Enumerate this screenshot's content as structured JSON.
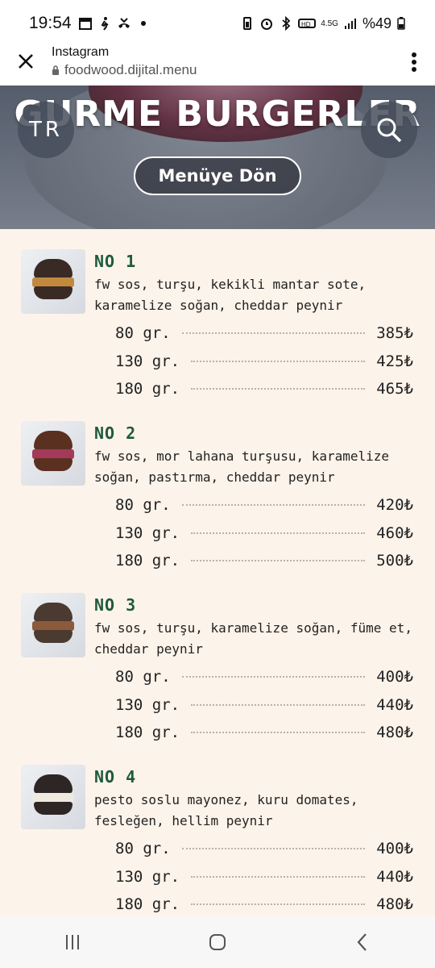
{
  "status_bar": {
    "time": "19:54",
    "left_icons": [
      "calendar-icon",
      "walking-icon",
      "missed-call-icon",
      "dot-icon"
    ],
    "right_icons": [
      "battery-saver-icon",
      "alarm-icon",
      "bluetooth-icon",
      "hd-voice-icon",
      "signal-icon"
    ],
    "network": "4.5G",
    "battery": "%49"
  },
  "browser": {
    "title": "Instagram",
    "url": "foodwood.dijital.menu"
  },
  "hero": {
    "title": "GURME BURGERLER",
    "lang": "TR",
    "back_label": "Menüye Dön"
  },
  "items": [
    {
      "name": "NO 1",
      "desc": "fw sos, turşu, kekikli mantar sote, karamelize soğan, cheddar peynir",
      "prices": [
        {
          "size": "80 gr.",
          "price": "385₺"
        },
        {
          "size": "130 gr.",
          "price": "425₺"
        },
        {
          "size": "180 gr.",
          "price": "465₺"
        }
      ]
    },
    {
      "name": "NO 2",
      "desc": "fw sos, mor lahana turşusu, karamelize soğan, pastırma, cheddar peynir",
      "prices": [
        {
          "size": "80 gr.",
          "price": "420₺"
        },
        {
          "size": "130 gr.",
          "price": "460₺"
        },
        {
          "size": "180 gr.",
          "price": "500₺"
        }
      ]
    },
    {
      "name": "NO 3",
      "desc": "fw sos, turşu, karamelize soğan, füme et, cheddar peynir",
      "prices": [
        {
          "size": "80 gr.",
          "price": "400₺"
        },
        {
          "size": "130 gr.",
          "price": "440₺"
        },
        {
          "size": "180 gr.",
          "price": "480₺"
        }
      ]
    },
    {
      "name": "NO 4",
      "desc": "pesto soslu mayonez, kuru domates, fesleğen, hellim peynir",
      "prices": [
        {
          "size": "80 gr.",
          "price": "400₺"
        },
        {
          "size": "130 gr.",
          "price": "440₺"
        },
        {
          "size": "180 gr.",
          "price": "480₺"
        }
      ]
    }
  ],
  "nav": [
    "recent-apps-icon",
    "home-icon",
    "back-icon"
  ],
  "colors": {
    "accent_green": "#1e5a3c",
    "page_bg": "#fcf3ea"
  }
}
